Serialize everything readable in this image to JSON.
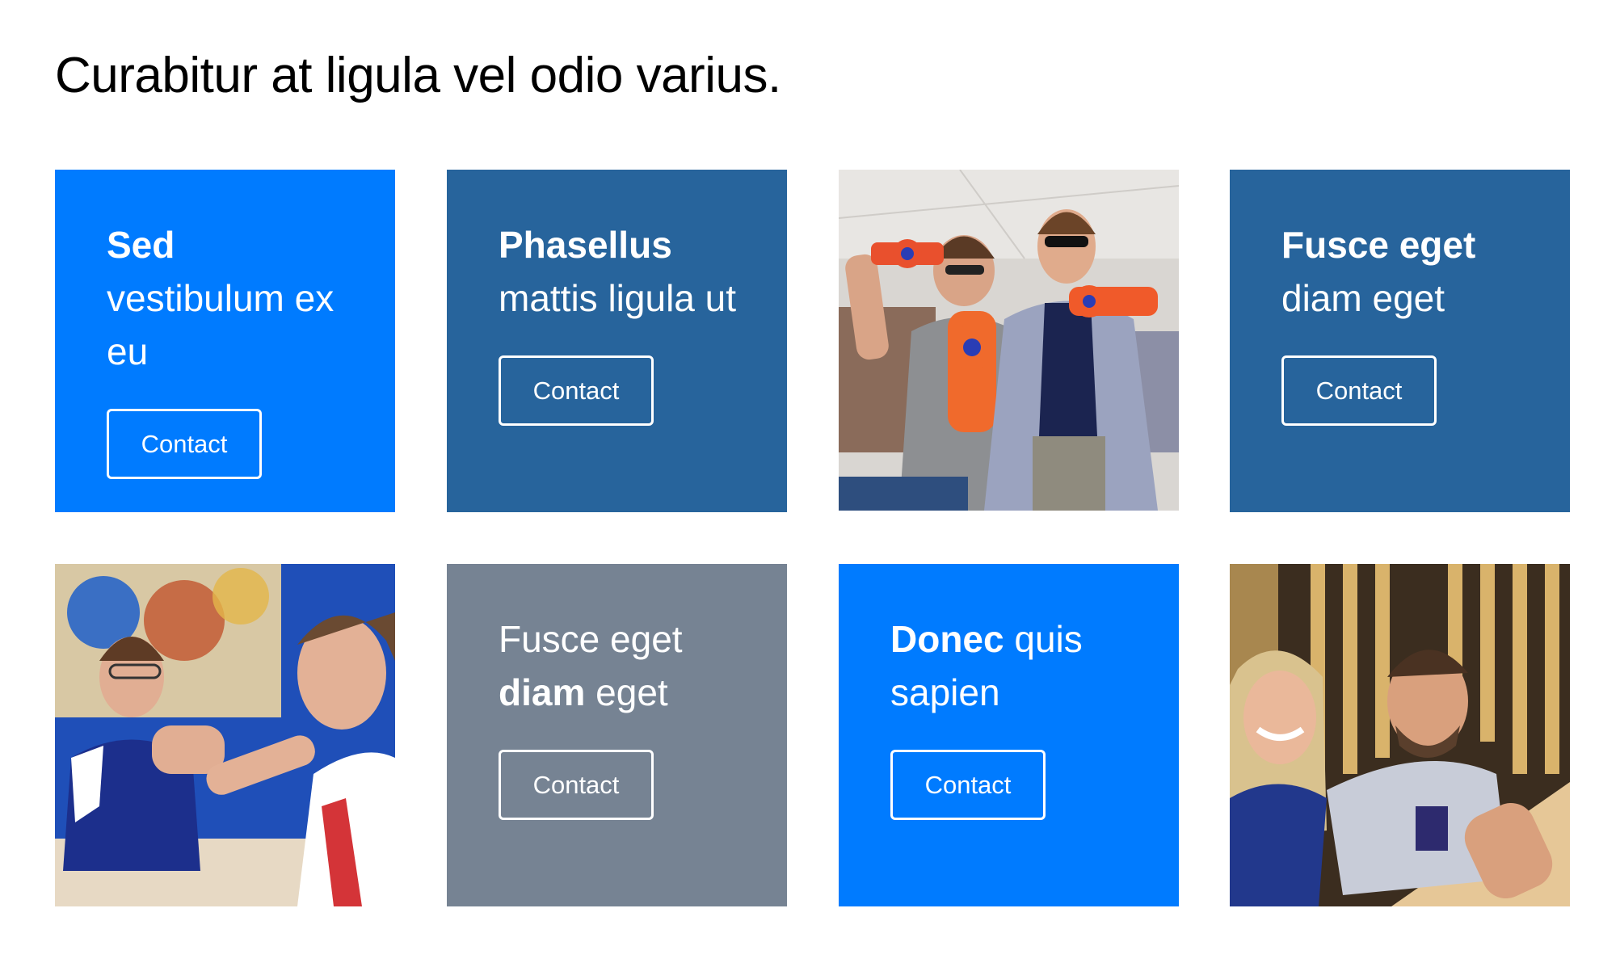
{
  "page": {
    "title": "Curabitur at ligula vel odio varius."
  },
  "colors": {
    "bright_blue": "#007bff",
    "steel_blue": "#27649c",
    "slate_gray": "#768393",
    "button_border": "#ffffff"
  },
  "tiles": [
    {
      "type": "text",
      "color": "#007bff",
      "bold": "Sed",
      "regular": " vestibulum ex eu",
      "button": "Contact"
    },
    {
      "type": "text",
      "color": "#27649c",
      "bold": "Phasellus",
      "regular": " mattis ligula ut",
      "button": "Contact"
    },
    {
      "type": "photo",
      "content": "two-men-with-toy-blasters-photo"
    },
    {
      "type": "text",
      "color": "#27649c",
      "bold": "Fusce eget",
      "regular": " diam eget",
      "button": "Contact"
    },
    {
      "type": "photo",
      "content": "arm-wrestling-photo"
    },
    {
      "type": "text",
      "color": "#768393",
      "regular_before": "Fusce eget ",
      "bold": "diam",
      "regular": " eget",
      "button": "Contact"
    },
    {
      "type": "text",
      "color": "#007bff",
      "bold": "Donec",
      "regular": " quis sapien",
      "button": "Contact"
    },
    {
      "type": "photo",
      "content": "couple-at-table-photo"
    }
  ]
}
